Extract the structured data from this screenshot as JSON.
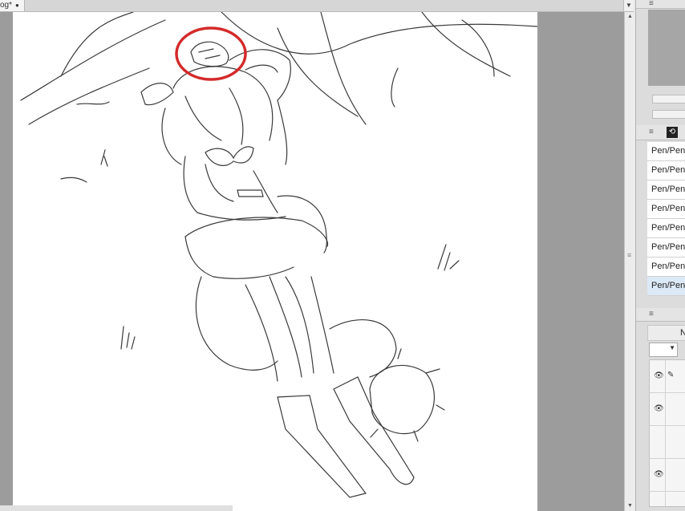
{
  "document_tab": {
    "title": "og*",
    "modified_dot": "●"
  },
  "scroll": {
    "up": "▲",
    "down": "▼"
  },
  "panels": {
    "subtool_items": [
      {
        "label": "Pen/Pen"
      },
      {
        "label": "Pen/Pen"
      },
      {
        "label": "Pen/Pen"
      },
      {
        "label": "Pen/Pen"
      },
      {
        "label": "Pen/Pen"
      },
      {
        "label": "Pen/Pen"
      },
      {
        "label": "Pen/Pen"
      },
      {
        "label": "Pen/Pen",
        "selected": true
      }
    ],
    "layer_header": "N",
    "menu_glyph": "≡"
  },
  "annotation": {
    "shape": "ellipse",
    "color": "#d42a2a"
  },
  "colors": {
    "canvas": "#ffffff",
    "pasteboard": "#9c9c9c",
    "selection": "#dce9f6"
  }
}
